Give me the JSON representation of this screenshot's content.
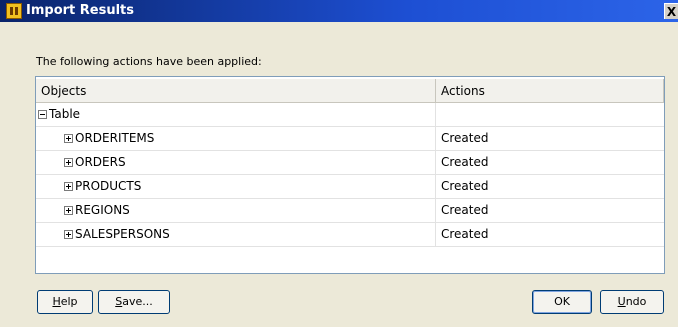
{
  "window": {
    "title": "Import Results",
    "close_glyph": "X",
    "icon": "app-icon"
  },
  "intro_text": "The following actions have been applied:",
  "table": {
    "columns": [
      "Objects",
      "Actions"
    ],
    "group": {
      "label": "Table",
      "expanded": true,
      "action": ""
    },
    "rows": [
      {
        "label": "ORDERITEMS",
        "action": "Created"
      },
      {
        "label": "ORDERS",
        "action": "Created"
      },
      {
        "label": "PRODUCTS",
        "action": "Created"
      },
      {
        "label": "REGIONS",
        "action": "Created"
      },
      {
        "label": "SALESPERSONS",
        "action": "Created"
      }
    ]
  },
  "buttons": {
    "help": {
      "mnemonic": "H",
      "rest": "elp"
    },
    "save": {
      "mnemonic": "S",
      "rest": "ave..."
    },
    "ok": {
      "label": "OK"
    },
    "undo": {
      "mnemonic": "U",
      "rest": "ndo"
    }
  },
  "colors": {
    "titlebar": "#0a246a",
    "dialog_bg": "#ece9d8",
    "table_border": "#7f9db9"
  }
}
